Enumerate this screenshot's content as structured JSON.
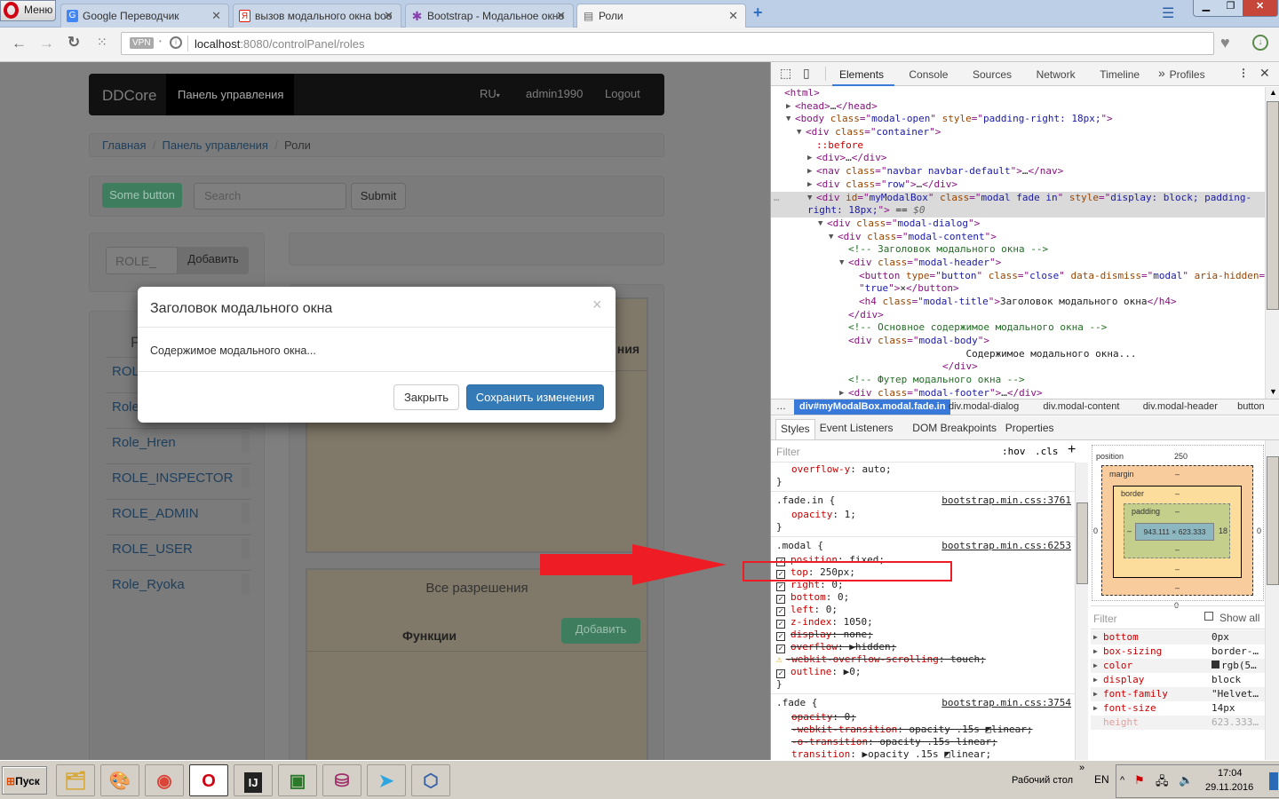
{
  "browser": {
    "menu_label": "Меню",
    "tabs": [
      {
        "title": "Google Переводчик",
        "favicon": "google-translate-icon",
        "color": "#4285f4",
        "glyph": "G"
      },
      {
        "title": "вызов модального окна boo",
        "favicon": "yandex-icon",
        "color": "#e61400",
        "glyph": "Я"
      },
      {
        "title": "Bootstrap - Модальное окно",
        "favicon": "bootstrap-icon",
        "color": "#8a3fb0",
        "glyph": "✱"
      },
      {
        "title": "Роли",
        "favicon": "page-icon",
        "color": "#777777",
        "glyph": "▤"
      }
    ],
    "vpn": "VPN",
    "url_host": "localhost",
    "url_rest": ":8080/controlPanel/roles"
  },
  "navbar": {
    "brand": "DDCore",
    "active": "Панель управления",
    "lang": "RU",
    "user": "admin1990",
    "logout": "Logout"
  },
  "breadcrumb": [
    "Главная",
    "Панель управления",
    "Роли"
  ],
  "toolbar": {
    "some_button": "Some button",
    "search_placeholder": "Search",
    "submit": "Submit"
  },
  "role_form": {
    "input_value": "ROLE_",
    "add": "Добавить"
  },
  "roles_panel": {
    "heading_partial": "Р",
    "roles": [
      "ROLE_",
      "Role_",
      "Role_Hren",
      "ROLE_INSPECTOR",
      "ROLE_ADMIN",
      "ROLE_USER",
      "Role_Ryoka"
    ]
  },
  "right_panel": {
    "heading_partial": "ния",
    "permissions_title": "Все разрешения",
    "functions": "Функции",
    "add": "Добавить"
  },
  "modal": {
    "title": "Заголовок модального окна",
    "close_symbol": "×",
    "body": "Содержимое модального окна...",
    "close_btn": "Закрыть",
    "save_btn": "Сохранить изменения",
    "primary_color": "#337ab7"
  },
  "annotation": {
    "arrow_color": "#ee1c24"
  },
  "devtools": {
    "tabs": [
      "Elements",
      "Console",
      "Sources",
      "Network",
      "Timeline",
      "Profiles"
    ],
    "active_tab": "Elements",
    "more": "»",
    "tree": [
      {
        "d": 0,
        "a": "",
        "t": [
          [
            "tag",
            "<html>"
          ]
        ]
      },
      {
        "d": 1,
        "a": "▶",
        "t": [
          [
            "tag",
            "<head>"
          ],
          [
            "txt",
            "…"
          ],
          [
            "tag",
            "</head>"
          ]
        ]
      },
      {
        "d": 1,
        "a": "▼",
        "t": [
          [
            "tag",
            "<body "
          ],
          [
            "attr",
            "class"
          ],
          [
            "tag",
            "=\""
          ],
          [
            "val",
            "modal-open"
          ],
          [
            "tag",
            "\" "
          ],
          [
            "attr",
            "style"
          ],
          [
            "tag",
            "=\""
          ],
          [
            "val",
            "padding-right: 18px;"
          ],
          [
            "tag",
            "\">"
          ]
        ]
      },
      {
        "d": 2,
        "a": "▼",
        "t": [
          [
            "tag",
            "<div "
          ],
          [
            "attr",
            "class"
          ],
          [
            "tag",
            "=\""
          ],
          [
            "val",
            "container"
          ],
          [
            "tag",
            "\">"
          ]
        ]
      },
      {
        "d": 3,
        "a": "",
        "t": [
          [
            "pseudo",
            "::before"
          ]
        ]
      },
      {
        "d": 3,
        "a": "▶",
        "t": [
          [
            "tag",
            "<div>"
          ],
          [
            "txt",
            "…"
          ],
          [
            "tag",
            "</div>"
          ]
        ]
      },
      {
        "d": 3,
        "a": "▶",
        "t": [
          [
            "tag",
            "<nav "
          ],
          [
            "attr",
            "class"
          ],
          [
            "tag",
            "=\""
          ],
          [
            "val",
            "navbar navbar-default"
          ],
          [
            "tag",
            "\">"
          ],
          [
            "txt",
            "…"
          ],
          [
            "tag",
            "</nav>"
          ]
        ]
      },
      {
        "d": 3,
        "a": "▶",
        "t": [
          [
            "tag",
            "<div "
          ],
          [
            "attr",
            "class"
          ],
          [
            "tag",
            "=\""
          ],
          [
            "val",
            "row"
          ],
          [
            "tag",
            "\">"
          ],
          [
            "txt",
            "…"
          ],
          [
            "tag",
            "</div>"
          ]
        ]
      },
      {
        "d": 3,
        "a": "▼",
        "sel": true,
        "t": [
          [
            "tag",
            "<div "
          ],
          [
            "attr",
            "id"
          ],
          [
            "tag",
            "=\""
          ],
          [
            "val",
            "myModalBox"
          ],
          [
            "tag",
            "\" "
          ],
          [
            "attr",
            "class"
          ],
          [
            "tag",
            "=\""
          ],
          [
            "val",
            "modal fade in"
          ],
          [
            "tag",
            "\" "
          ],
          [
            "attr",
            "style"
          ],
          [
            "tag",
            "=\""
          ],
          [
            "val",
            "display: block; padding-"
          ]
        ]
      },
      {
        "d": 3,
        "a": "",
        "sel": true,
        "cont": true,
        "t": [
          [
            "val",
            "right: 18px;"
          ],
          [
            "tag",
            "\">"
          ],
          [
            "txt",
            " == "
          ],
          [
            "txt",
            "$0"
          ]
        ]
      },
      {
        "d": 4,
        "a": "▼",
        "t": [
          [
            "tag",
            "<div "
          ],
          [
            "attr",
            "class"
          ],
          [
            "tag",
            "=\""
          ],
          [
            "val",
            "modal-dialog"
          ],
          [
            "tag",
            "\">"
          ]
        ]
      },
      {
        "d": 5,
        "a": "▼",
        "t": [
          [
            "tag",
            "<div "
          ],
          [
            "attr",
            "class"
          ],
          [
            "tag",
            "=\""
          ],
          [
            "val",
            "modal-content"
          ],
          [
            "tag",
            "\">"
          ]
        ]
      },
      {
        "d": 6,
        "a": "",
        "t": [
          [
            "cmt",
            "<!-- Заголовок модального окна -->"
          ]
        ]
      },
      {
        "d": 6,
        "a": "▼",
        "t": [
          [
            "tag",
            "<div "
          ],
          [
            "attr",
            "class"
          ],
          [
            "tag",
            "=\""
          ],
          [
            "val",
            "modal-header"
          ],
          [
            "tag",
            "\">"
          ]
        ]
      },
      {
        "d": 7,
        "a": "",
        "t": [
          [
            "tag",
            "<button "
          ],
          [
            "attr",
            "type"
          ],
          [
            "tag",
            "=\""
          ],
          [
            "val",
            "button"
          ],
          [
            "tag",
            "\" "
          ],
          [
            "attr",
            "class"
          ],
          [
            "tag",
            "=\""
          ],
          [
            "val",
            "close"
          ],
          [
            "tag",
            "\" "
          ],
          [
            "attr",
            "data-dismiss"
          ],
          [
            "tag",
            "=\""
          ],
          [
            "val",
            "modal"
          ],
          [
            "tag",
            "\" "
          ],
          [
            "attr",
            "aria-hidden"
          ],
          [
            "tag",
            "="
          ]
        ]
      },
      {
        "d": 7,
        "a": "",
        "t": [
          [
            "tag",
            "\""
          ],
          [
            "val",
            "true"
          ],
          [
            "tag",
            "\">"
          ],
          [
            "txt",
            "×"
          ],
          [
            "tag",
            "</button>"
          ]
        ]
      },
      {
        "d": 7,
        "a": "",
        "t": [
          [
            "tag",
            "<h4 "
          ],
          [
            "attr",
            "class"
          ],
          [
            "tag",
            "=\""
          ],
          [
            "val",
            "modal-title"
          ],
          [
            "tag",
            "\">"
          ],
          [
            "txt",
            "Заголовок модального окна"
          ],
          [
            "tag",
            "</h4>"
          ]
        ]
      },
      {
        "d": 6,
        "a": "",
        "t": [
          [
            "tag",
            "</div>"
          ]
        ]
      },
      {
        "d": 6,
        "a": "",
        "t": [
          [
            "cmt",
            "<!-- Основное содержимое модального окна -->"
          ]
        ]
      },
      {
        "d": 6,
        "a": "",
        "t": [
          [
            "tag",
            "<div "
          ],
          [
            "attr",
            "class"
          ],
          [
            "tag",
            "=\""
          ],
          [
            "val",
            "modal-body"
          ],
          [
            "tag",
            "\">"
          ]
        ]
      },
      {
        "d": 6,
        "a": "",
        "t": [
          [
            "txt",
            "                    Содержимое модального окна..."
          ]
        ]
      },
      {
        "d": 6,
        "a": "",
        "t": [
          [
            "tag",
            "                </div>"
          ]
        ]
      },
      {
        "d": 6,
        "a": "",
        "t": [
          [
            "cmt",
            "<!-- Футер модального окна -->"
          ]
        ]
      },
      {
        "d": 6,
        "a": "▶",
        "t": [
          [
            "tag",
            "<div "
          ],
          [
            "attr",
            "class"
          ],
          [
            "tag",
            "=\""
          ],
          [
            "val",
            "modal-footer"
          ],
          [
            "tag",
            "\">"
          ],
          [
            "txt",
            "…"
          ],
          [
            "tag",
            "</div>"
          ]
        ]
      }
    ],
    "crumbs": [
      "…",
      "div#myModalBox.modal.fade.in",
      "div.modal-dialog",
      "div.modal-content",
      "div.modal-header",
      "button"
    ],
    "style_tabs": [
      "Styles",
      "Event Listeners",
      "DOM Breakpoints",
      "Properties"
    ],
    "filter_placeholder": "Filter",
    "hov": ":hov",
    "cls": ".cls",
    "rules": [
      {
        "selector": "",
        "source": "",
        "props": [
          {
            "n": "overflow-y",
            "v": "auto",
            "plain": true
          }
        ]
      },
      {
        "selector": ".fade.in {",
        "source": "bootstrap.min.css:3761",
        "props": [
          {
            "n": "opacity",
            "v": "1",
            "plain": true
          }
        ]
      },
      {
        "selector": ".modal {",
        "source": "bootstrap.min.css:6253",
        "props": [
          {
            "n": "position",
            "v": "fixed",
            "cb": true,
            "strike": false
          },
          {
            "n": "top",
            "v": "250px",
            "cb": true
          },
          {
            "n": "right",
            "v": "0",
            "cb": true
          },
          {
            "n": "bottom",
            "v": "0",
            "cb": true
          },
          {
            "n": "left",
            "v": "0",
            "cb": true
          },
          {
            "n": "z-index",
            "v": "1050",
            "cb": true
          },
          {
            "n": "display",
            "v": "none",
            "cb": true,
            "strike": true
          },
          {
            "n": "overflow",
            "v": "▶hidden",
            "cb": true,
            "strike": true
          },
          {
            "n": "-webkit-overflow-scrolling",
            "v": "touch",
            "warn": true,
            "strike": true
          },
          {
            "n": "outline",
            "v": "▶0",
            "cb": true
          }
        ]
      },
      {
        "selector": ".fade {",
        "source": "bootstrap.min.css:3754",
        "props": [
          {
            "n": "opacity",
            "v": "0",
            "plain": true,
            "strike": true
          },
          {
            "n": "-webkit-transition",
            "v": "opacity .15s ◩linear",
            "plain": true,
            "strike": true
          },
          {
            "n": "-o-transition",
            "v": "opacity .15s linear",
            "plain": true,
            "strike": true
          },
          {
            "n": "transition",
            "v": "▶opacity .15s ◩linear",
            "plain": true
          }
        ]
      }
    ],
    "box_model": {
      "position_label": "position",
      "position": "250",
      "margin_label": "margin",
      "border_label": "border",
      "padding_label": "padding",
      "dash": "–",
      "content": "943.111 × 623.333",
      "padding_right": "18",
      "pos_left": "0",
      "pos_right": "0",
      "pos_bottom": "0"
    },
    "computed_filter": "Filter",
    "show_all": "Show all",
    "computed": [
      {
        "n": "bottom",
        "v": "0px"
      },
      {
        "n": "box-sizing",
        "v": "border-…"
      },
      {
        "n": "color",
        "v": "rgb(5…",
        "swatch": "#333333"
      },
      {
        "n": "display",
        "v": "block"
      },
      {
        "n": "font-family",
        "v": "\"Helvet…"
      },
      {
        "n": "font-size",
        "v": "14px"
      },
      {
        "n": "height",
        "v": "623.333…",
        "dim": true
      }
    ]
  },
  "taskbar": {
    "start": "Пуск",
    "apps": [
      "explorer-icon",
      "paint-icon",
      "chrome-icon",
      "opera-icon",
      "intellij-icon",
      "terminal-icon",
      "database-icon",
      "telegram-icon",
      "virtualbox-icon"
    ],
    "desktop": "Рабочий стол",
    "lang": "EN",
    "time": "17:04",
    "date": "29.11.2016"
  }
}
